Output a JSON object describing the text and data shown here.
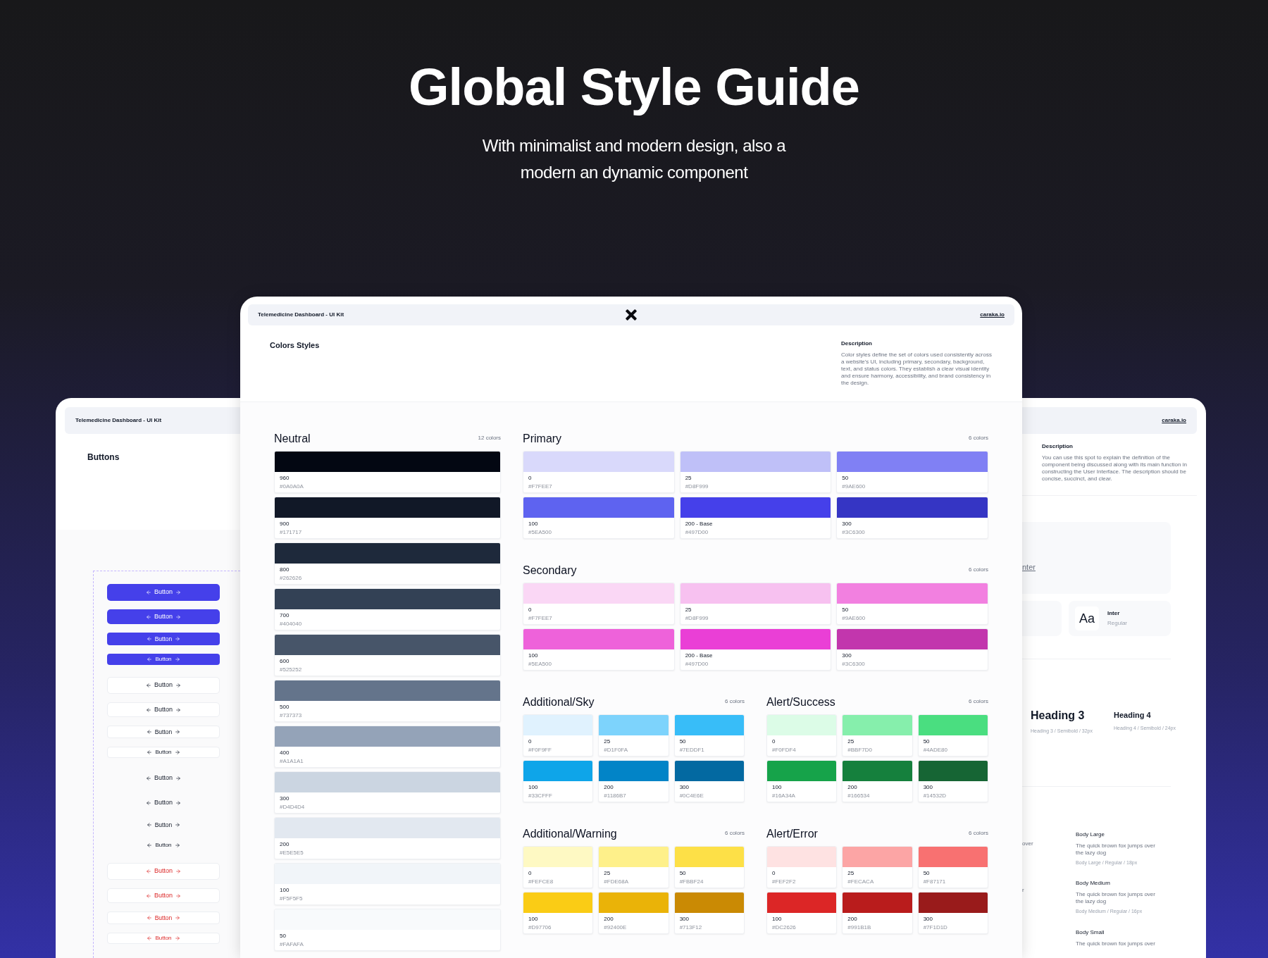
{
  "hero": {
    "title": "Global Style Guide",
    "subtitle_lines": [
      "With minimalist and modern design, also a",
      "modern an dynamic component"
    ]
  },
  "left_card": {
    "header_title": "Telemedicine Dashboard - UI Kit",
    "section_title": "Buttons",
    "buttons": [
      {
        "kind": "primary-large",
        "label": "Button"
      },
      {
        "kind": "primary-medium",
        "label": "Button"
      },
      {
        "kind": "primary-small",
        "label": "Button"
      },
      {
        "kind": "primary-tiny",
        "label": "Button"
      },
      {
        "kind": "secondary-large",
        "label": "Button"
      },
      {
        "kind": "secondary-medium",
        "label": "Button"
      },
      {
        "kind": "secondary-small",
        "label": "Button"
      },
      {
        "kind": "secondary-tiny",
        "label": "Button"
      },
      {
        "kind": "tertiary-large",
        "label": "Button"
      },
      {
        "kind": "tertiary-medium",
        "label": "Button"
      },
      {
        "kind": "tertiary-small",
        "label": "Button"
      },
      {
        "kind": "tertiary-tiny",
        "label": "Button"
      },
      {
        "kind": "destructive-large",
        "label": "Button"
      },
      {
        "kind": "destructive-medium",
        "label": "Button"
      },
      {
        "kind": "destructive-small",
        "label": "Button"
      },
      {
        "kind": "destructive-tiny",
        "label": "Button"
      }
    ]
  },
  "center_card": {
    "header_title": "Telemedicine Dashboard - UI Kit",
    "link": "caraka.io",
    "section_title": "Colors Styles",
    "description_title": "Description",
    "description": "Color styles define the set of colors used consistently across a website's UI, including primary, secondary, background, text, and status colors. They establish a clear visual identity and ensure harmony, accessibility, and brand consistency in the design.",
    "palettes": [
      {
        "name": "Neutral",
        "count": "12 colors",
        "swatches": [
          {
            "value": "960",
            "hex": "#0A0A0A",
            "color": "#030712"
          },
          {
            "value": "900",
            "hex": "#171717",
            "color": "#111827"
          },
          {
            "value": "800",
            "hex": "#262626",
            "color": "#1e293b"
          },
          {
            "value": "700",
            "hex": "#404040",
            "color": "#334155"
          },
          {
            "value": "600",
            "hex": "#525252",
            "color": "#475569"
          },
          {
            "value": "500",
            "hex": "#737373",
            "color": "#64748b"
          },
          {
            "value": "400",
            "hex": "#A1A1A1",
            "color": "#94a3b8"
          },
          {
            "value": "300",
            "hex": "#D4D4D4",
            "color": "#cbd5e1"
          },
          {
            "value": "200",
            "hex": "#E5E5E5",
            "color": "#e2e8f0"
          },
          {
            "value": "100",
            "hex": "#F5F5F5",
            "color": "#f1f5f9"
          },
          {
            "value": "50",
            "hex": "#FAFAFA",
            "color": "#f8fafc"
          }
        ]
      },
      {
        "name": "Primary",
        "count": "6 colors",
        "swatches": [
          {
            "value": "0",
            "hex": "#F7FEE7",
            "color": "#d9d9fb"
          },
          {
            "value": "25",
            "hex": "#D8F999",
            "color": "#bfc0f8"
          },
          {
            "value": "50",
            "hex": "#9AE600",
            "color": "#8080f4"
          },
          {
            "value": "100",
            "hex": "#5EA500",
            "color": "#5e63f0"
          },
          {
            "value": "200 - Base",
            "hex": "#497D00",
            "color": "#4540ea"
          },
          {
            "value": "300",
            "hex": "#3C6300",
            "color": "#3535c4"
          }
        ]
      },
      {
        "name": "Secondary",
        "count": "6 colors",
        "swatches": [
          {
            "value": "0",
            "hex": "#F7FEE7",
            "color": "#fad7f5"
          },
          {
            "value": "25",
            "hex": "#D8F999",
            "color": "#f7c1f0"
          },
          {
            "value": "50",
            "hex": "#9AE600",
            "color": "#f280e0"
          },
          {
            "value": "100",
            "hex": "#5EA500",
            "color": "#ee62da"
          },
          {
            "value": "200 - Base",
            "hex": "#497D00",
            "color": "#ea3fd6"
          },
          {
            "value": "300",
            "hex": "#3C6300",
            "color": "#c236ad"
          }
        ]
      },
      {
        "name": "Additional/Sky",
        "count": "6 colors",
        "swatches": [
          {
            "value": "0",
            "hex": "#F0F9FF",
            "color": "#e0f2fe"
          },
          {
            "value": "25",
            "hex": "#D1F0FA",
            "color": "#7dd3fc"
          },
          {
            "value": "50",
            "hex": "#7EDDF1",
            "color": "#38bdf8"
          },
          {
            "value": "100",
            "hex": "#33CFFF",
            "color": "#0ea5e9"
          },
          {
            "value": "200",
            "hex": "#1186B7",
            "color": "#0284c7"
          },
          {
            "value": "300",
            "hex": "#0C4E6E",
            "color": "#0369a1"
          }
        ]
      },
      {
        "name": "Alert/Success",
        "count": "6 colors",
        "swatches": [
          {
            "value": "0",
            "hex": "#F0FDF4",
            "color": "#dcfce7"
          },
          {
            "value": "25",
            "hex": "#BBF7D0",
            "color": "#86efac"
          },
          {
            "value": "50",
            "hex": "#4ADE80",
            "color": "#4ade80"
          },
          {
            "value": "100",
            "hex": "#16A34A",
            "color": "#16a34a"
          },
          {
            "value": "200",
            "hex": "#166534",
            "color": "#15803d"
          },
          {
            "value": "300",
            "hex": "#14532D",
            "color": "#166534"
          }
        ]
      },
      {
        "name": "Additional/Warning",
        "count": "6 colors",
        "swatches": [
          {
            "value": "0",
            "hex": "#FEFCE8",
            "color": "#fef9c3"
          },
          {
            "value": "25",
            "hex": "#FDE68A",
            "color": "#fef08a"
          },
          {
            "value": "50",
            "hex": "#FBBF24",
            "color": "#fde047"
          },
          {
            "value": "100",
            "hex": "#D97706",
            "color": "#facc15"
          },
          {
            "value": "200",
            "hex": "#92400E",
            "color": "#eab308"
          },
          {
            "value": "300",
            "hex": "#713F12",
            "color": "#ca8a04"
          }
        ]
      },
      {
        "name": "Alert/Error",
        "count": "6 colors",
        "swatches": [
          {
            "value": "0",
            "hex": "#FEF2F2",
            "color": "#fee2e2"
          },
          {
            "value": "25",
            "hex": "#FECACA",
            "color": "#fca5a5"
          },
          {
            "value": "50",
            "hex": "#F87171",
            "color": "#f87171"
          },
          {
            "value": "100",
            "hex": "#DC2626",
            "color": "#dc2626"
          },
          {
            "value": "200",
            "hex": "#991B1B",
            "color": "#b91c1c"
          },
          {
            "value": "300",
            "hex": "#7F1D1D",
            "color": "#991b1b"
          }
        ]
      }
    ]
  },
  "right_card": {
    "link": "caraka.io",
    "description_title": "Description",
    "description": "You can use this spot to explain the definition of the component being discussed along with its main function in constructing the User Interface. The description should be concise, succinct, and clear.",
    "font_link": "nter",
    "font_sample": "Aa",
    "font_name": "Inter",
    "font_weight": "Regular",
    "headings": [
      {
        "title": "Heading 3",
        "spec": "Heading 3 / Semibold / 32px"
      },
      {
        "title": "Heading 4",
        "spec": "Heading 4 / Semibold / 24px"
      }
    ],
    "left_fragments": [
      "over",
      "r"
    ],
    "body_styles": [
      {
        "title": "Body Large",
        "sample": "The quick brown fox jumps over the lazy dog",
        "spec": "Body Large / Regular / 18px"
      },
      {
        "title": "Body Medium",
        "sample": "The quick brown fox jumps over the lazy dog",
        "spec": "Body Medium / Regular / 16px"
      },
      {
        "title": "Body Small",
        "sample": "The quick brown fox jumps over"
      }
    ]
  }
}
